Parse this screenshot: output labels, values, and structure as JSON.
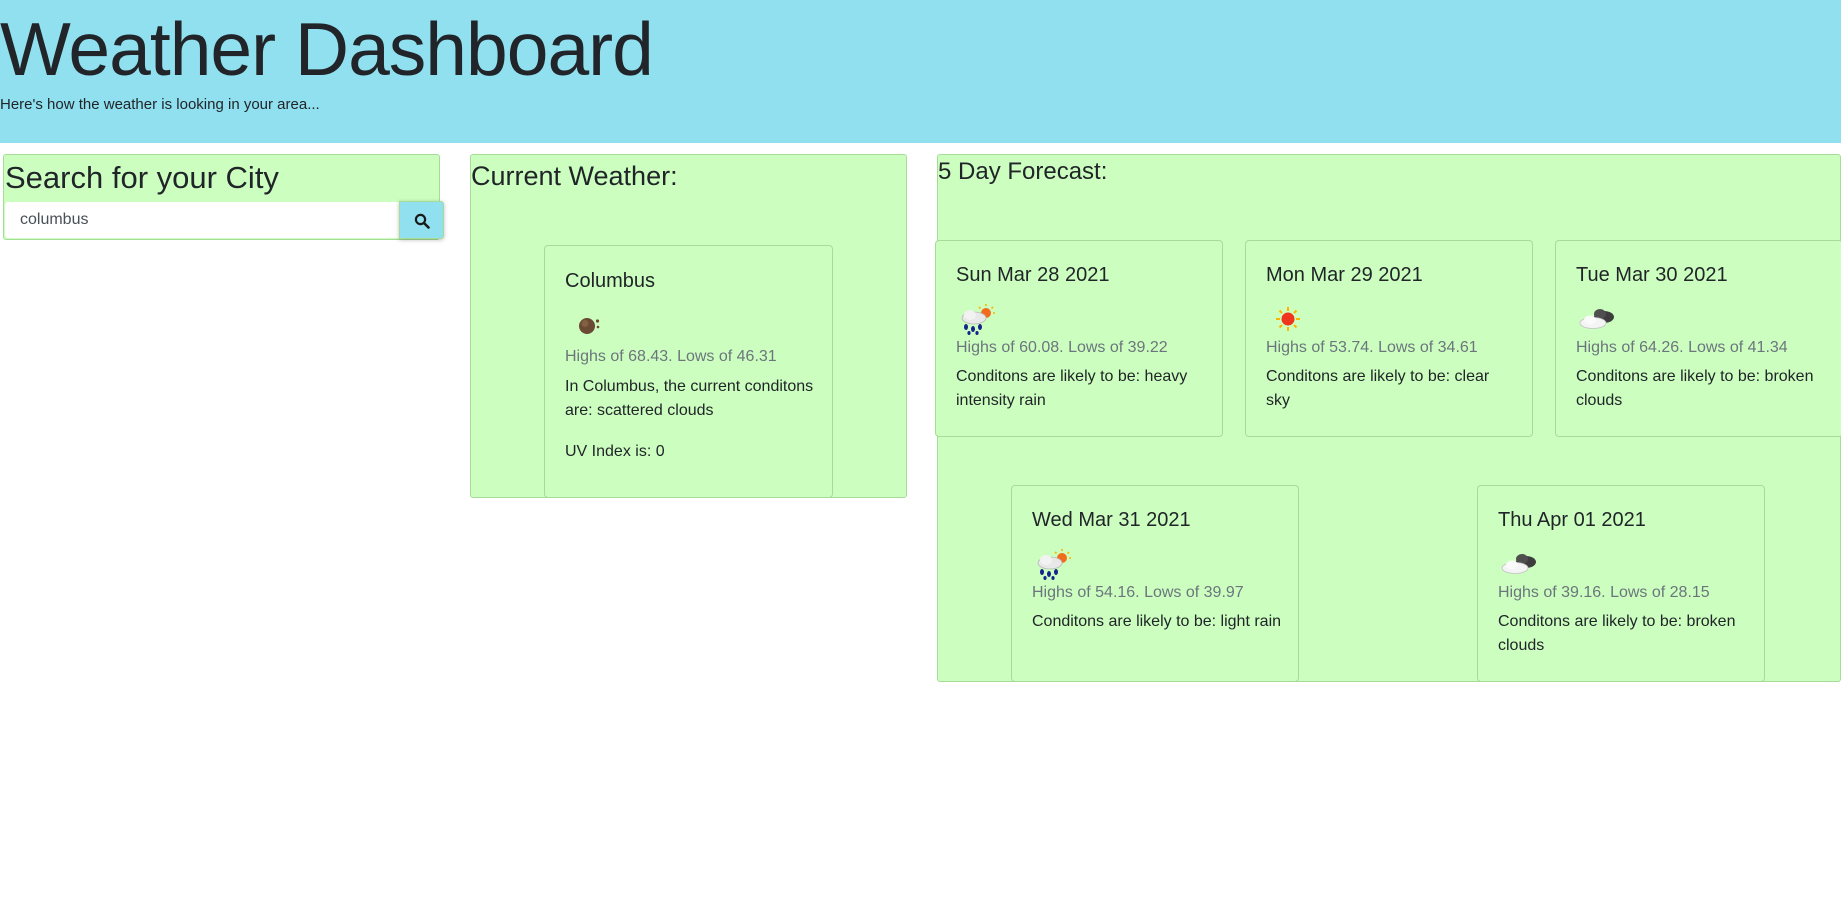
{
  "header": {
    "title": "Weather Dashboard",
    "subtitle": "Here's how the weather is looking in your area..."
  },
  "search": {
    "heading": "Search for your City",
    "value": "columbus",
    "button_icon": "search-icon"
  },
  "current": {
    "heading": "Current Weather:",
    "city": "Columbus",
    "icon": "scattered-clouds-icon",
    "hilo": "Highs of 68.43. Lows of 46.31",
    "description": "In Columbus, the current conditons are: scattered clouds",
    "uv": "UV Index is: 0"
  },
  "forecast": {
    "heading": "5 Day Forecast:",
    "days": [
      {
        "date": "Sun Mar 28 2021",
        "icon": "rain-sun-icon",
        "hilo": "Highs of 60.08. Lows of 39.22",
        "description": "Conditons are likely to be: heavy intensity rain"
      },
      {
        "date": "Mon Mar 29 2021",
        "icon": "sun-icon",
        "hilo": "Highs of 53.74. Lows of 34.61",
        "description": "Conditons are likely to be: clear sky"
      },
      {
        "date": "Tue Mar 30 2021",
        "icon": "broken-clouds-icon",
        "hilo": "Highs of 64.26. Lows of 41.34",
        "description": "Conditons are likely to be: broken clouds"
      },
      {
        "date": "Wed Mar 31 2021",
        "icon": "rain-sun-icon",
        "hilo": "Highs of 54.16. Lows of 39.97",
        "description": "Conditons are likely to be: light rain"
      },
      {
        "date": "Thu Apr 01 2021",
        "icon": "broken-clouds-icon",
        "hilo": "Highs of 39.16. Lows of 28.15",
        "description": "Conditons are likely to be: broken clouds"
      }
    ]
  },
  "colors": {
    "header_bg": "#90e0ef",
    "panel_bg": "#ccffbf",
    "panel_border": "#a6dc98",
    "muted_text": "#6c757d"
  }
}
